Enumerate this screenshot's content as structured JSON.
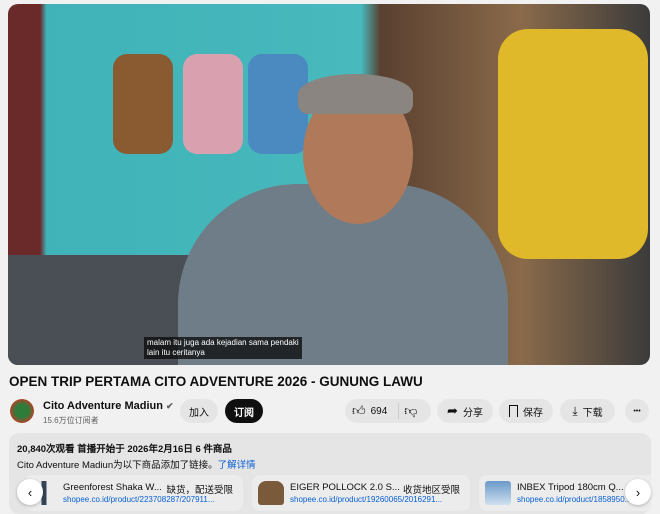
{
  "video": {
    "caption_line1": "malam itu juga ada kejadian sama pendaki",
    "caption_line2": "lain itu ceritanya"
  },
  "title": "OPEN TRIP PERTAMA CITO ADVENTURE 2026 - GUNUNG LAWU",
  "channel": {
    "name": "Cito Adventure Madiun",
    "verified_icon": "✔",
    "subscribers": "15.6万位订阅者",
    "join_label": "加入",
    "subscribe_label": "订阅"
  },
  "actions": {
    "likes": "694",
    "share": "分享",
    "save": "保存",
    "download": "下载",
    "more": "•••"
  },
  "description": {
    "meta": "20,840次观看  首播开始于 2026年2月16日  6 件商品",
    "note": "Cito Adventure Madiun为以下商品添加了链接。",
    "learn_more": "了解详情"
  },
  "products": [
    {
      "name": "Greenforest Shaka W...",
      "status": "缺货，配送受限",
      "url": "shopee.co.id/product/223708287/207911..."
    },
    {
      "name": "EIGER POLLOCK 2.0 S...",
      "status": "收货地区受限",
      "url": "shopee.co.id/product/19260065/2016291..."
    },
    {
      "name": "INBEX Tripod 180cm Q...",
      "status": "",
      "url": "shopee.co.id/product/1858950..."
    }
  ],
  "nav": {
    "prev": "‹",
    "next": "›"
  }
}
